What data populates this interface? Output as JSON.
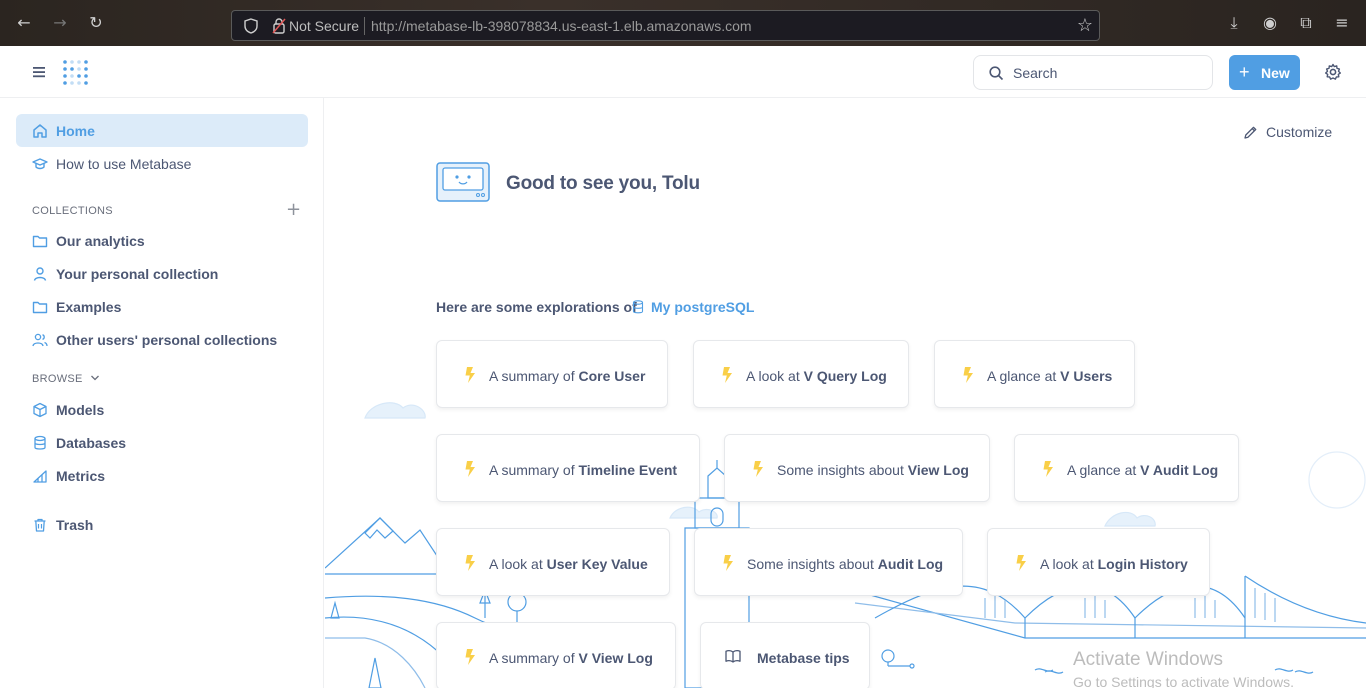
{
  "browser": {
    "security_label": "Not Secure",
    "url": "http://metabase-lb-398078834.us-east-1.elb.amazonaws.com"
  },
  "header": {
    "search_placeholder": "Search",
    "new_label": "New"
  },
  "sidebar": {
    "items": [
      {
        "label": "Home",
        "icon": "home-icon",
        "active": true
      },
      {
        "label": "How to use Metabase",
        "icon": "graduation-cap-icon"
      }
    ],
    "collections_heading": "COLLECTIONS",
    "collections": [
      {
        "label": "Our analytics",
        "icon": "folder-icon"
      },
      {
        "label": "Your personal collection",
        "icon": "person-icon"
      },
      {
        "label": "Examples",
        "icon": "folder-icon"
      },
      {
        "label": "Other users' personal collections",
        "icon": "group-icon"
      }
    ],
    "browse_heading": "BROWSE",
    "browse": [
      {
        "label": "Models",
        "icon": "cube-icon"
      },
      {
        "label": "Databases",
        "icon": "database-icon"
      },
      {
        "label": "Metrics",
        "icon": "metric-icon"
      }
    ],
    "trash_label": "Trash"
  },
  "main": {
    "customize_label": "Customize",
    "greeting": "Good to see you, Tolu",
    "explore_text": "Here are some explorations of",
    "database_name": "My postgreSQL",
    "cards": [
      {
        "prefix": "A summary of",
        "subject": "Core User"
      },
      {
        "prefix": "A look at",
        "subject": "V Query Log"
      },
      {
        "prefix": "A glance at",
        "subject": "V Users"
      },
      {
        "prefix": "A summary of",
        "subject": "Timeline Event"
      },
      {
        "prefix": "Some insights about",
        "subject": "View Log"
      },
      {
        "prefix": "A glance at",
        "subject": "V Audit Log"
      },
      {
        "prefix": "A look at",
        "subject": "User Key Value"
      },
      {
        "prefix": "Some insights about",
        "subject": "Audit Log"
      },
      {
        "prefix": "A look at",
        "subject": "Login History"
      },
      {
        "prefix": "A summary of",
        "subject": "V View Log"
      }
    ],
    "tips_label": "Metabase tips"
  },
  "watermark": {
    "line1": "Activate Windows",
    "line2": "Go to Settings to activate Windows."
  },
  "colors": {
    "brand": "#509ee3",
    "bolt": "#f9cf48",
    "text": "#4c5773"
  }
}
